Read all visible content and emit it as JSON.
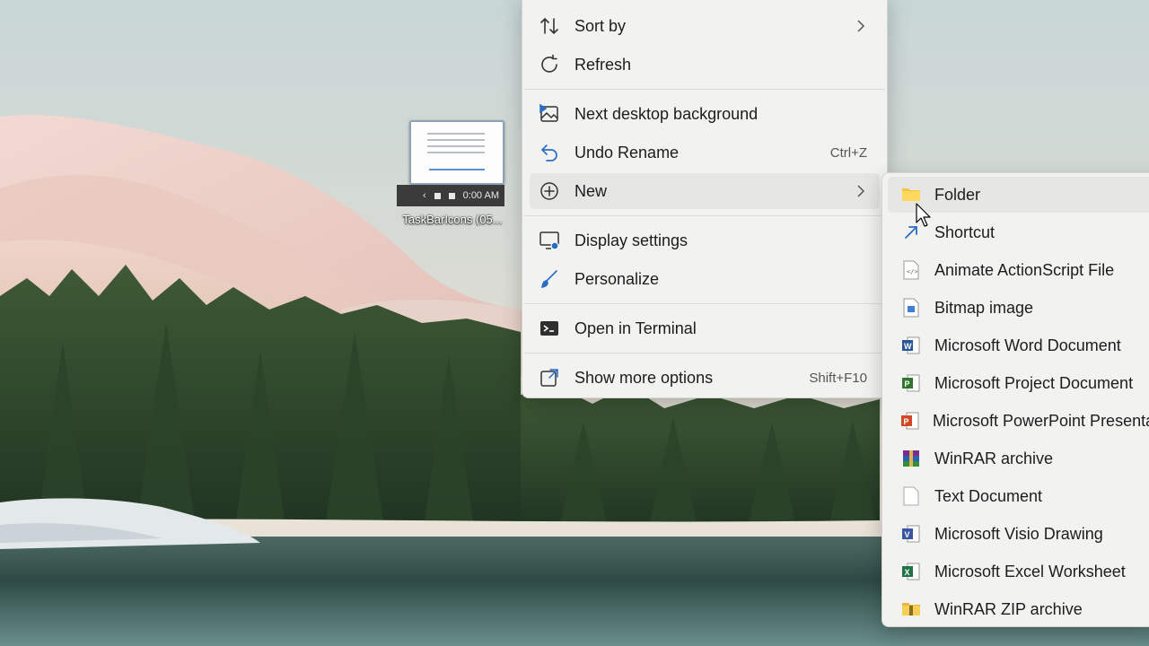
{
  "desktop": {
    "icon": {
      "label": "TaskBarIcons (05...",
      "taskbar_time": "0:00 AM"
    }
  },
  "context_menu": {
    "items": [
      {
        "label": "Sort by",
        "icon": "sort-icon",
        "submenu": true
      },
      {
        "label": "Refresh",
        "icon": "refresh-icon"
      },
      {
        "label": "Next desktop background",
        "icon": "next-background-icon"
      },
      {
        "label": "Undo Rename",
        "icon": "undo-icon",
        "shortcut": "Ctrl+Z"
      },
      {
        "label": "New",
        "icon": "new-icon",
        "submenu": true
      },
      {
        "label": "Display settings",
        "icon": "display-settings-icon"
      },
      {
        "label": "Personalize",
        "icon": "personalize-icon"
      },
      {
        "label": "Open in Terminal",
        "icon": "terminal-icon"
      },
      {
        "label": "Show more options",
        "icon": "more-options-icon",
        "shortcut": "Shift+F10"
      }
    ]
  },
  "new_submenu": {
    "items": [
      {
        "label": "Folder",
        "icon": "folder-icon"
      },
      {
        "label": "Shortcut",
        "icon": "shortcut-icon"
      },
      {
        "label": "Animate ActionScript File",
        "icon": "actionscript-file-icon"
      },
      {
        "label": "Bitmap image",
        "icon": "bitmap-icon"
      },
      {
        "label": "Microsoft Word Document",
        "icon": "word-icon"
      },
      {
        "label": "Microsoft Project Document",
        "icon": "project-icon"
      },
      {
        "label": "Microsoft PowerPoint Presentation",
        "icon": "powerpoint-icon"
      },
      {
        "label": "WinRAR archive",
        "icon": "winrar-icon"
      },
      {
        "label": "Text Document",
        "icon": "text-document-icon"
      },
      {
        "label": "Microsoft Visio Drawing",
        "icon": "visio-icon"
      },
      {
        "label": "Microsoft Excel Worksheet",
        "icon": "excel-icon"
      },
      {
        "label": "WinRAR ZIP archive",
        "icon": "winrar-zip-icon"
      }
    ]
  },
  "colors": {
    "menu_bg": "#f2f3f1",
    "hover_bg": "#e6e7e5",
    "accent": "#2b6cc4"
  }
}
